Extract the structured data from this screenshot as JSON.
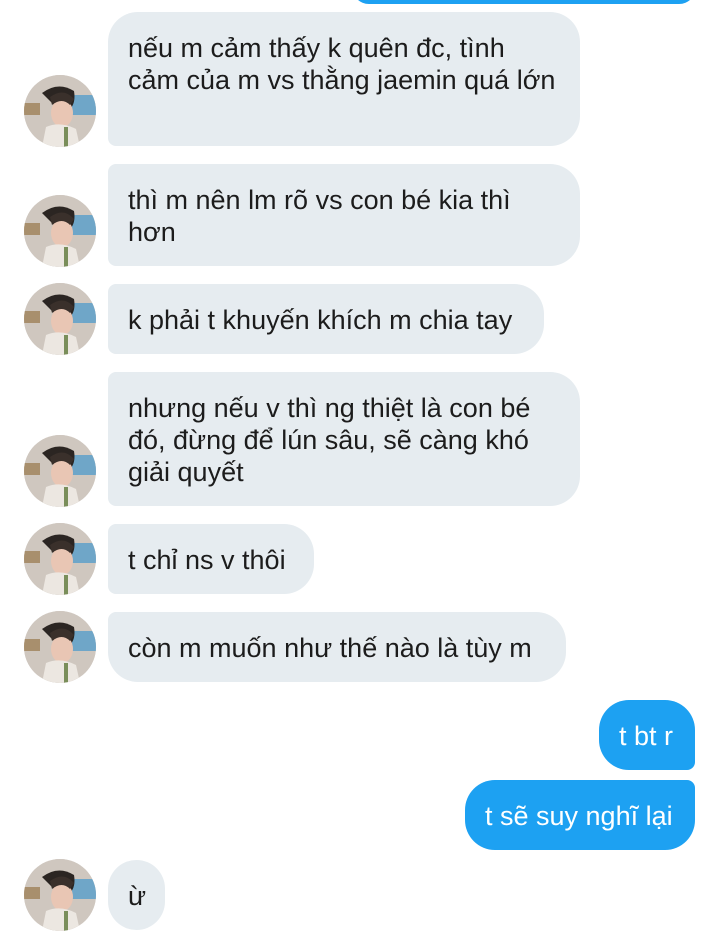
{
  "conversation": {
    "messages": [
      {
        "side": "in",
        "text": "nếu m cảm thấy k quên đc, tình cảm của m vs thằng jaemin quá lớn"
      },
      {
        "side": "in",
        "text": "thì m nên lm rõ vs con bé kia thì hơn"
      },
      {
        "side": "in",
        "text": "k phải t khuyến khích m chia tay"
      },
      {
        "side": "in",
        "text": "nhưng nếu v thì ng thiệt là con bé đó, đừng để lún sâu, sẽ càng khó giải quyết"
      },
      {
        "side": "in",
        "text": "t chỉ ns v thôi"
      },
      {
        "side": "in",
        "text": "còn m muốn như thế nào là tùy m"
      },
      {
        "side": "out",
        "text": "t bt r"
      },
      {
        "side": "out",
        "text": "t sẽ suy nghĩ lại"
      },
      {
        "side": "in",
        "text": "ừ"
      }
    ]
  },
  "colors": {
    "incoming_bubble": "#e6ecf0",
    "outgoing_bubble": "#1da1f2",
    "incoming_text": "#1c1c1c",
    "outgoing_text": "#ffffff"
  },
  "icons": {
    "avatar": "contact-avatar-photo"
  }
}
